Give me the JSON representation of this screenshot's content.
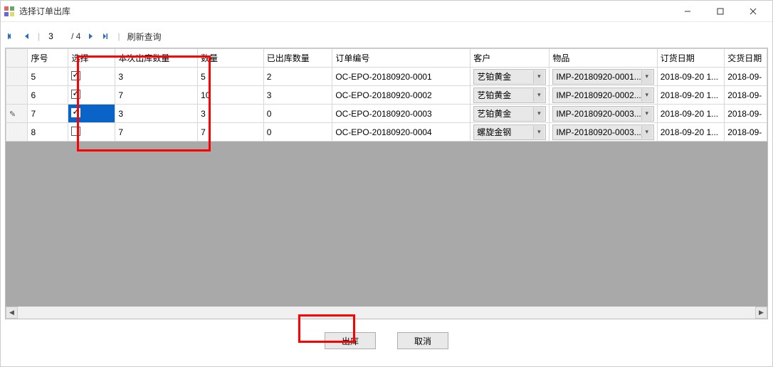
{
  "window": {
    "title": "选择订单出库"
  },
  "nav": {
    "current_page": "3",
    "total_pages": "/ 4",
    "refresh_label": "刷新查询"
  },
  "columns": {
    "seq": "序号",
    "select": "选择",
    "out_qty": "本次出库数量",
    "qty": "数量",
    "outed": "已出库数量",
    "order_no": "订单编号",
    "customer": "客户",
    "item": "物品",
    "order_date": "订货日期",
    "deliver_date": "交货日期"
  },
  "rows": [
    {
      "seq": "5",
      "selected": true,
      "active_row": false,
      "out_qty": "3",
      "qty": "5",
      "outed": "2",
      "order_no": "OC-EPO-20180920-0001",
      "customer": "艺铂黄金",
      "item": "IMP-20180920-0001...",
      "order_date": "2018-09-20 1...",
      "deliver_date": "2018-09-"
    },
    {
      "seq": "6",
      "selected": true,
      "active_row": false,
      "out_qty": "7",
      "qty": "10",
      "outed": "3",
      "order_no": "OC-EPO-20180920-0002",
      "customer": "艺铂黄金",
      "item": "IMP-20180920-0002...",
      "order_date": "2018-09-20 1...",
      "deliver_date": "2018-09-"
    },
    {
      "seq": "7",
      "selected": true,
      "active_row": true,
      "out_qty": "3",
      "qty": "3",
      "outed": "0",
      "order_no": "OC-EPO-20180920-0003",
      "customer": "艺铂黄金",
      "item": "IMP-20180920-0003...",
      "order_date": "2018-09-20 1...",
      "deliver_date": "2018-09-"
    },
    {
      "seq": "8",
      "selected": false,
      "active_row": false,
      "out_qty": "7",
      "qty": "7",
      "outed": "0",
      "order_no": "OC-EPO-20180920-0004",
      "customer": "螺旋金钢",
      "item": "IMP-20180920-0003...",
      "order_date": "2018-09-20 1...",
      "deliver_date": "2018-09-"
    }
  ],
  "footer": {
    "ok_label": "出库",
    "cancel_label": "取消"
  }
}
